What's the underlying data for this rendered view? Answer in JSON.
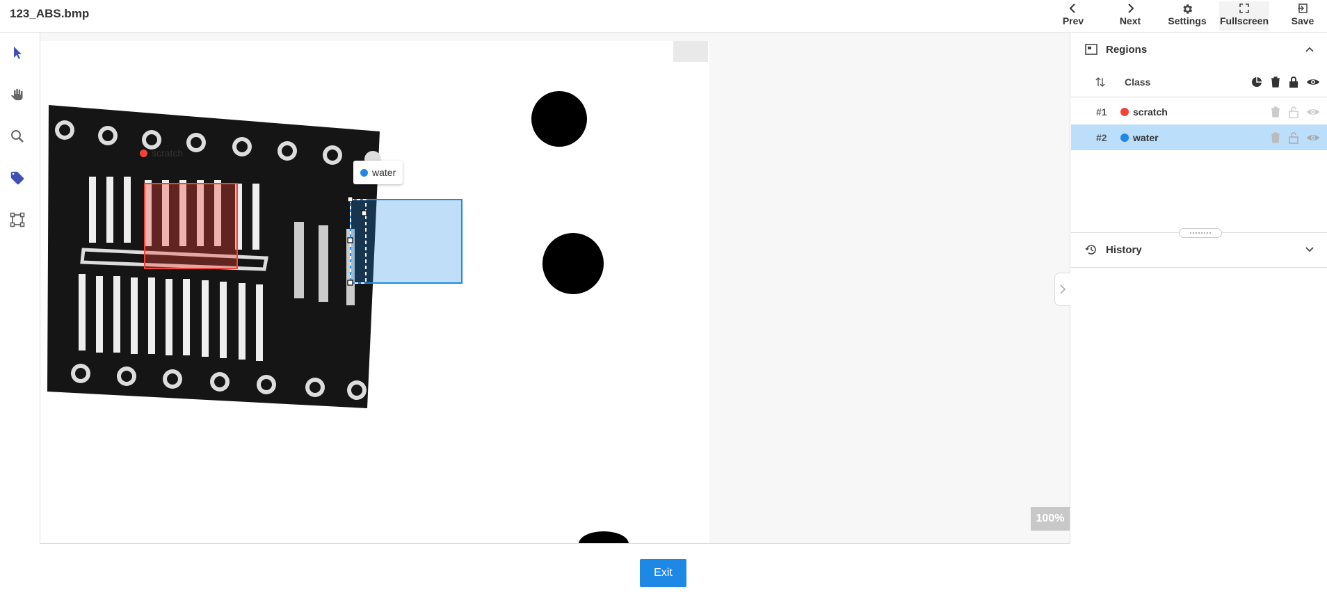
{
  "header": {
    "file_name": "123_ABS.bmp",
    "buttons": [
      {
        "label": "Prev",
        "icon": "chevron-left-icon"
      },
      {
        "label": "Next",
        "icon": "chevron-right-icon"
      },
      {
        "label": "Settings",
        "icon": "gear-icon"
      },
      {
        "label": "Fullscreen",
        "icon": "fullscreen-icon"
      },
      {
        "label": "Save",
        "icon": "exit-to-app-icon"
      }
    ]
  },
  "left_tools": [
    {
      "name": "select-tool",
      "icon": "cursor-icon",
      "active": true
    },
    {
      "name": "pan-tool",
      "icon": "hand-icon"
    },
    {
      "name": "zoom-tool",
      "icon": "magnifier-icon"
    },
    {
      "name": "tag-tool",
      "icon": "tag-icon"
    },
    {
      "name": "bounding-box-tool",
      "icon": "box-vertices-icon"
    }
  ],
  "canvas": {
    "zoom": "100%",
    "annotations": [
      {
        "label": "scratch",
        "color": "#f44336"
      },
      {
        "label": "water",
        "color": "#1e88e5",
        "selected": true
      }
    ]
  },
  "regions_panel": {
    "title": "Regions",
    "class_header": "Class",
    "regions": [
      {
        "index": "#1",
        "class": "scratch",
        "color": "#f44336",
        "selected": false
      },
      {
        "index": "#2",
        "class": "water",
        "color": "#1e88e5",
        "selected": true
      }
    ]
  },
  "history_panel": {
    "title": "History"
  },
  "footer": {
    "exit_label": "Exit"
  },
  "colors": {
    "accent": "#1e88e5",
    "selected_row": "#bbdefb",
    "scratch": "#f44336",
    "water": "#1e88e5"
  }
}
